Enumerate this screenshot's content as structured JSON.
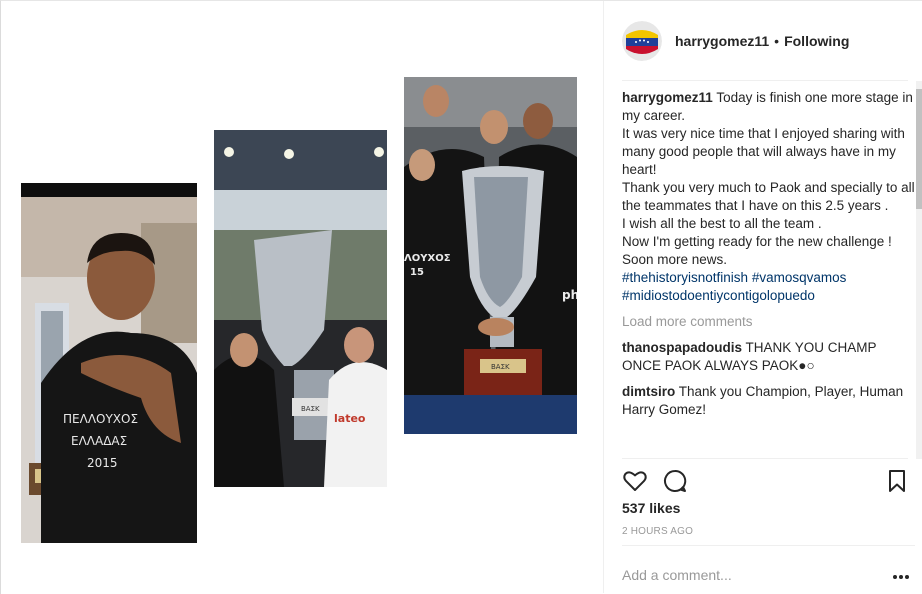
{
  "post": {
    "username": "harrygomez11",
    "separator": "•",
    "follow_status": "Following",
    "avatar_icon": "venezuela-flag-badge-icon"
  },
  "caption": {
    "username": "harrygomez11",
    "lines": [
      "Today is finish one more stage in my career.",
      "It was very nice time that I enjoyed sharing with many good people that will always have in my heart!",
      "Thank you very much to Paok and specially to all the teammates that I have on this 2.5 years .",
      "I wish all the best to all the team .",
      "Now I'm getting ready for the new challenge !",
      "Soon more news."
    ],
    "hashtags": "#thehistoryisnotfinish #vamosqvamos #midiostodoentiycontigolopuedo"
  },
  "load_more": "Load more comments",
  "comments": [
    {
      "username": "thanospapadoudis",
      "text": "THANK YOU CHAMP ONCE PAOK ALWAYS PAOK●○"
    },
    {
      "username": "dimtsiro",
      "text": "Thank you Champion, Player, Human Harry Gomez!"
    }
  ],
  "photos": {
    "shirt_line1": "ΠΕΛΛΟΥΧΟΣ",
    "shirt_line2": "ΕΛΛΑΔΑΣ",
    "shirt_line3": "2015",
    "jersey_text": "ΛΟΥΧΟΣ",
    "jersey_number": "15",
    "sponsor_text": "lateo",
    "trophy_plate": "ΒΑΣΚ",
    "ph_text": "ph"
  },
  "actions": {
    "like_icon": "heart-icon",
    "comment_icon": "speech-bubble-icon",
    "save_icon": "bookmark-icon"
  },
  "likes": "537 likes",
  "timestamp": "2 HOURS AGO",
  "add_comment": {
    "placeholder": "Add a comment..."
  },
  "more_icon": "ellipsis-icon"
}
